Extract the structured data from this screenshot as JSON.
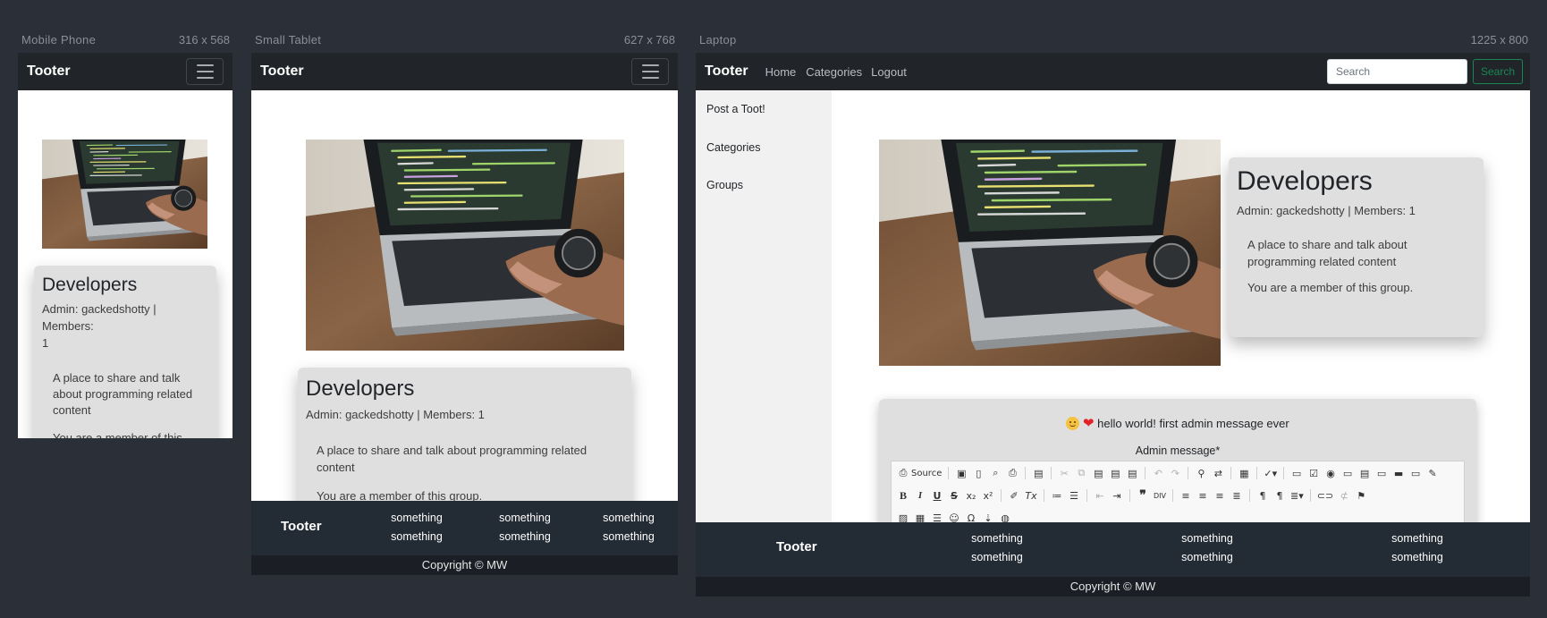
{
  "devices": {
    "mobile": {
      "label": "Mobile Phone",
      "size": "316 x 568"
    },
    "tablet": {
      "label": "Small Tablet",
      "size": "627 x 768"
    },
    "laptop": {
      "label": "Laptop",
      "size": "1225 x 800"
    }
  },
  "app": {
    "brand": "Tooter"
  },
  "nav": {
    "home": "Home",
    "categories": "Categories",
    "logout": "Logout",
    "search_placeholder": "Search",
    "search_button": "Search"
  },
  "sidebar": {
    "items": [
      "Post a Toot!",
      "Categories",
      "Groups"
    ]
  },
  "group": {
    "name": "Developers",
    "meta": "Admin: gackedshotty | Members: 1",
    "description": "A place to share and talk about programming related content",
    "membership": "You are a member of this group."
  },
  "mobile_card": {
    "meta_line1": "Admin: gackedshotty | Members:",
    "meta_line2": "1",
    "desc_line1": "A place to share and talk",
    "desc_line2": "about programming related",
    "desc_line3": "content",
    "membership_partial": "You are a member of this"
  },
  "admin": {
    "message": "hello world! first admin message ever",
    "label": "Admin message*",
    "source_button": "Source"
  },
  "footer": {
    "brand": "Tooter",
    "columns": [
      [
        "something",
        "something"
      ],
      [
        "something",
        "something"
      ],
      [
        "something",
        "something"
      ]
    ],
    "copyright": "Copyright © MW"
  },
  "icons": [
    "hamburger-icon",
    "smiley-emoji-icon",
    "heart-emoji-icon",
    "source-icon",
    "save-icon",
    "new-page-icon",
    "preview-icon",
    "print-icon",
    "templates-icon",
    "cut-icon",
    "copy-icon",
    "paste-icon",
    "paste-text-icon",
    "paste-word-icon",
    "undo-icon",
    "redo-icon",
    "find-icon",
    "replace-icon",
    "select-all-icon",
    "spellcheck-icon",
    "form-icon",
    "checkbox-icon",
    "radio-icon",
    "textfield-icon",
    "textarea-icon",
    "select-icon",
    "button-icon",
    "image-button-icon",
    "hidden-field-icon",
    "bold-icon",
    "italic-icon",
    "underline-icon",
    "strike-icon",
    "subscript-icon",
    "superscript-icon",
    "copy-format-icon",
    "remove-format-icon",
    "numbered-list-icon",
    "bulleted-list-icon",
    "outdent-icon",
    "indent-icon",
    "blockquote-icon",
    "div-icon",
    "align-left-icon",
    "align-center-icon",
    "align-right-icon",
    "justify-icon",
    "ltr-icon",
    "rtl-icon",
    "language-icon",
    "link-icon",
    "unlink-icon",
    "anchor-icon",
    "image-icon",
    "table-icon",
    "horizontal-line-icon",
    "smiley-icon",
    "special-char-icon",
    "page-break-icon",
    "iframe-icon"
  ],
  "colors": {
    "background": "#2b2f37",
    "navbar": "#212529",
    "footer": "#232b34",
    "copyright_bar": "#1b1f25",
    "card": "#dfdfdf",
    "search_accent": "#198754",
    "sidebar": "#f1f1f1"
  }
}
